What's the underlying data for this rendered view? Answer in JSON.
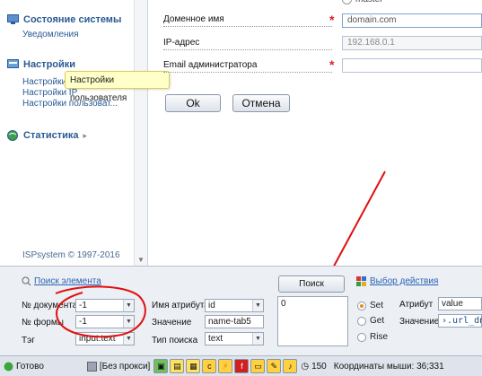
{
  "sidebar": {
    "section1": {
      "title": "Состояние системы",
      "items": [
        "Уведомления"
      ]
    },
    "section2": {
      "title": "Настройки",
      "items": [
        "Настройки",
        "Настройки IP",
        "Настройки пользоват..."
      ]
    },
    "section3": {
      "title": "Статистика"
    },
    "copyright": "ISPsystem © 1997-2016"
  },
  "tooltip": "Настройки пользователя",
  "form": {
    "top_partial": "master",
    "domain_label": "Доменное имя",
    "domain_value": "domain.com",
    "ip_label": "IP-адрес",
    "ip_value": "192.168.0.1",
    "email_label": "Email администратора",
    "email_value": "",
    "ok_label": "Ok",
    "cancel_label": "Отмена"
  },
  "inspector": {
    "find_element": "Поиск элемента",
    "search_button": "Поиск",
    "choose_action": "Выбор действия",
    "doc_label": "№ документа",
    "doc_value": "-1",
    "form_label": "№ формы",
    "form_value": "-1",
    "tag_label": "Тэг",
    "tag_value": "input:text",
    "attr_name_label": "Имя атрибута",
    "attr_name_value": "id",
    "value_label": "Значение",
    "value_value": "name-tab5",
    "search_type_label": "Тип поиска",
    "search_type_value": "text",
    "results": [
      "0"
    ],
    "radio_set": "Set",
    "radio_get": "Get",
    "radio_rise": "Rise",
    "attribute_label": "Атрибут",
    "attribute_value": "value",
    "value2_label": "Значение",
    "value2_value": "›.url_dns"
  },
  "statusbar": {
    "ready": "Готово",
    "proxy": "[Без прокси]",
    "count": "150",
    "coords": "Координаты мыши: 36;331"
  },
  "colors": {
    "annotation_red": "#e01010",
    "link_blue": "#2a5a94"
  }
}
